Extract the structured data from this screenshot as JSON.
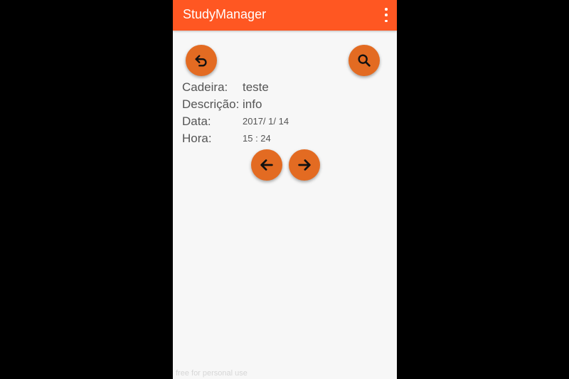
{
  "app": {
    "title": "StudyManager"
  },
  "icons": {
    "overflow": "more-vert-icon",
    "back": "undo-arrow-icon",
    "search": "search-icon",
    "previous": "arrow-left-icon",
    "next": "arrow-right-icon"
  },
  "details": {
    "cadeira_label": "Cadeira:",
    "cadeira_value": "teste",
    "descricao_label": "Descrição:",
    "descricao_value": "info",
    "data_label": "Data:",
    "data_value": "2017/ 1/ 14",
    "hora_label": "Hora:",
    "hora_value": "15 : 24"
  },
  "watermark": "free for personal use",
  "colors": {
    "appbar": "#ff5722",
    "fab": "#e36b22",
    "background": "#f7f7f7",
    "text": "#555555"
  }
}
